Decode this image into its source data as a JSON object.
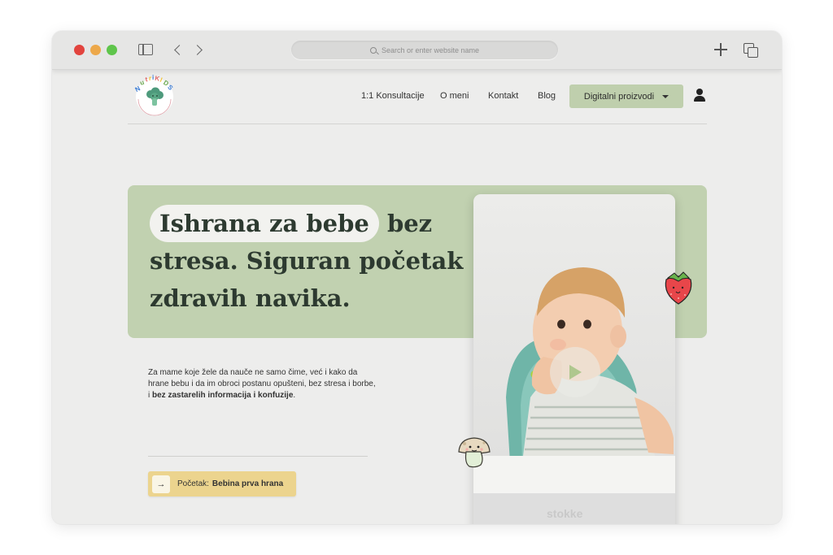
{
  "browser": {
    "url_placeholder": "Search or enter website name"
  },
  "site": {
    "logo_text": "NutriKIDS",
    "nav": {
      "links": [
        "1:1 Konsultacije",
        "O meni",
        "Kontakt",
        "Blog"
      ],
      "cta_label": "Digitalni proizvodi"
    }
  },
  "hero": {
    "title_highlight": "Ishrana za bebe",
    "title_line1_rest": "bez",
    "title_line2": "stresa. Siguran početak",
    "title_line3": "zdravih navika.",
    "description_plain": "Za mame koje žele da nauče ne samo čime, već i kako da hrane bebu i da im obroci postanu opušteni, bez stresa i borbe, i ",
    "description_bold": "bez zastarelih informacija i konfuzije",
    "description_end": ".",
    "cta_prefix": "Početak:",
    "cta_strong": "Bebina prva hrana",
    "cta_arrow": "→"
  },
  "colors": {
    "hero_panel": "#c1d1b0",
    "cta": "#ecd48e",
    "nav_cta": "#bfcfad"
  }
}
